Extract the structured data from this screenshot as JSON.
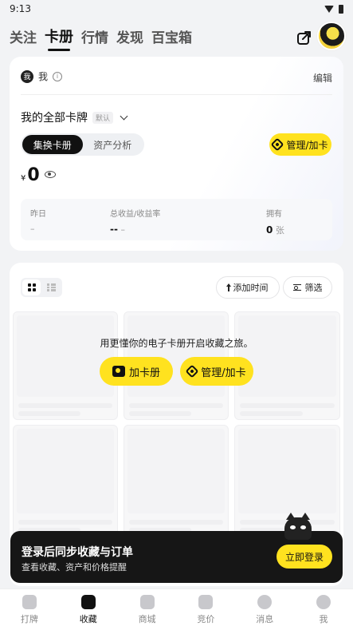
{
  "status": {
    "time": "9:13"
  },
  "top_tabs": [
    "关注",
    "卡册",
    "行情",
    "发现",
    "百宝箱"
  ],
  "profile": {
    "badge": "我",
    "name": "我",
    "edit": "编辑"
  },
  "album": {
    "title": "我的全部卡牌",
    "tag": "默认"
  },
  "segment": {
    "items": [
      "集换卡册",
      "资产分析"
    ],
    "active": 0
  },
  "manage_label": "管理/加卡",
  "balance": {
    "currency": "¥",
    "value": "0"
  },
  "stats": {
    "yesterday_label": "昨日",
    "yesterday_value": "–",
    "total_label": "总收益/收益率",
    "total_value": "--",
    "total_rate": "–",
    "owned_label": "拥有",
    "owned_value": "0",
    "owned_unit": "张"
  },
  "collection": {
    "add_time": "添加时间",
    "filter": "筛选",
    "empty_text": "用更懂你的电子卡册开启收藏之旅。",
    "add_album": "加卡册",
    "manage_album": "管理/加卡"
  },
  "banner": {
    "title": "登录后同步收藏与订单",
    "subtitle": "查看收藏、资产和价格提醒",
    "button": "立即登录"
  },
  "nav": [
    {
      "label": "打牌",
      "icon": "cards-icon"
    },
    {
      "label": "收藏",
      "icon": "collection-icon"
    },
    {
      "label": "商城",
      "icon": "shop-icon"
    },
    {
      "label": "竞价",
      "icon": "auction-icon"
    },
    {
      "label": "消息",
      "icon": "message-icon"
    },
    {
      "label": "我",
      "icon": "profile-icon"
    }
  ],
  "nav_active": 1,
  "colors": {
    "accent": "#ffe21f",
    "dark": "#111111"
  }
}
